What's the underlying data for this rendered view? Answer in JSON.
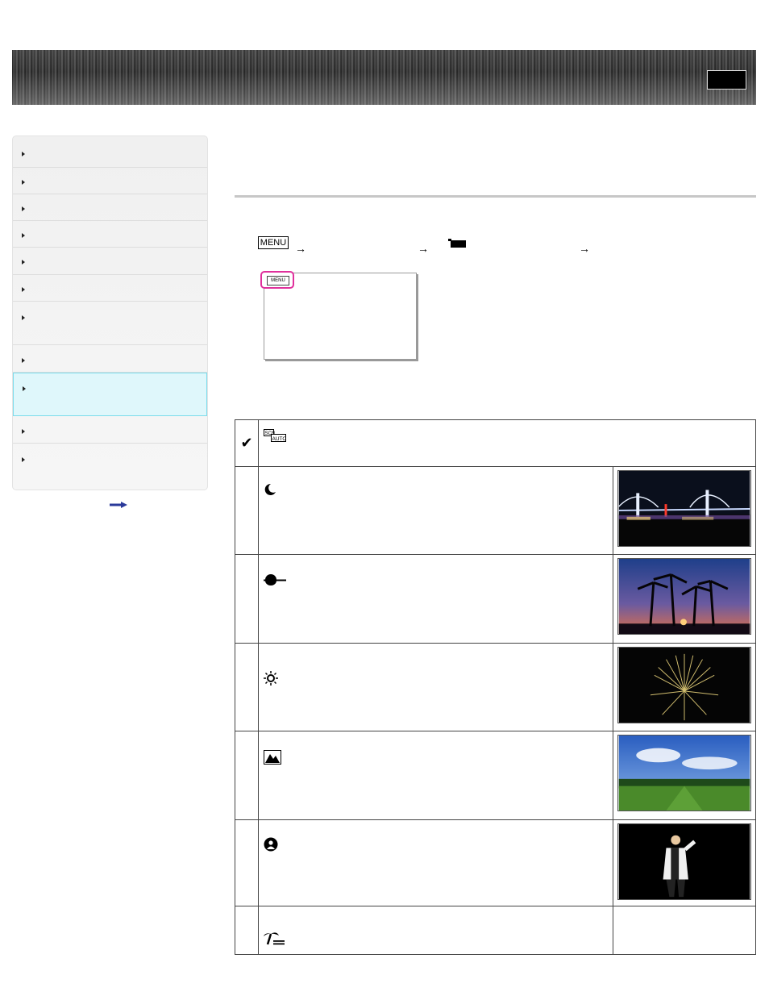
{
  "header": {
    "top_button_label": ""
  },
  "sidebar": {
    "items": [
      {
        "label": ""
      },
      {
        "label": ""
      },
      {
        "label": ""
      },
      {
        "label": ""
      },
      {
        "label": ""
      },
      {
        "label": ""
      },
      {
        "label": ""
      },
      {
        "label": ""
      },
      {
        "label": "",
        "active": true
      },
      {
        "label": ""
      },
      {
        "label": ""
      }
    ],
    "more_icon": "arrow-right-icon"
  },
  "main": {
    "page_title": "",
    "procedure": {
      "menu_key": "MENU",
      "arrow": "→",
      "camera_icon": "camera-mode-icon"
    },
    "screen_illustration": {
      "menu_button": "MENU"
    },
    "modes": [
      {
        "icon": "scn-auto-icon",
        "icon_text": "SCN AUTO",
        "selected": true,
        "checkmark": "✔",
        "has_thumb": false
      },
      {
        "icon": "night-scene-icon",
        "has_thumb": true,
        "thumb": "night-bridge-photo"
      },
      {
        "icon": "sunrise-sunset-icon",
        "has_thumb": true,
        "thumb": "sunset-palms-photo"
      },
      {
        "icon": "fireworks-icon",
        "has_thumb": true,
        "thumb": "fireworks-photo"
      },
      {
        "icon": "landscape-icon",
        "has_thumb": true,
        "thumb": "landscape-field-photo"
      },
      {
        "icon": "spotlight-icon",
        "has_thumb": true,
        "thumb": "spotlight-singer-photo"
      },
      {
        "icon": "beach-icon",
        "has_thumb": false
      }
    ]
  },
  "colors": {
    "active_nav_bg": "#dff7fb",
    "active_nav_border": "#7bdcec",
    "highlight_ring": "#e0309c",
    "more_arrow": "#2a3a9a"
  }
}
